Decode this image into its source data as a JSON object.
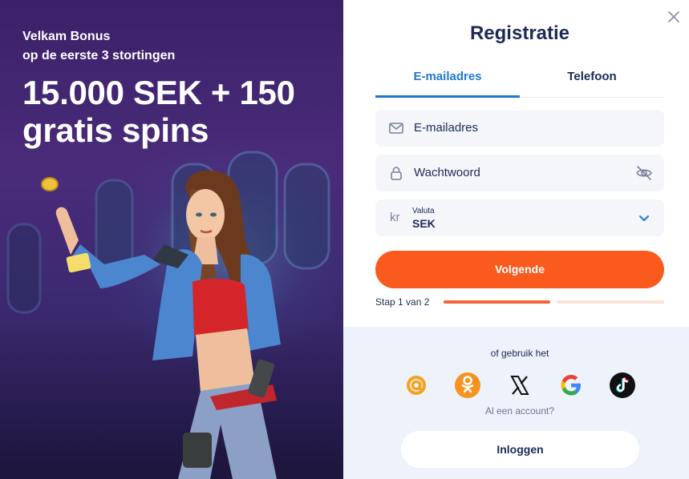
{
  "promo": {
    "line1": "Velkam Bonus",
    "line2": "op de eerste 3 stortingen",
    "title_line1": "15.000 SEK + 150",
    "title_line2": "gratis spins"
  },
  "registration": {
    "title": "Registratie",
    "tabs": [
      {
        "label": "E-mailadres",
        "active": true
      },
      {
        "label": "Telefoon",
        "active": false
      }
    ],
    "email_label": "E-mailadres",
    "password_label": "Wachtwoord",
    "currency": {
      "symbol": "kr",
      "caption": "Valuta",
      "value": "SEK"
    },
    "next_button": "Volgende",
    "step_text": "Stap 1 van 2",
    "step_progress": 0.5
  },
  "social": {
    "or_text": "of gebruik het",
    "providers": [
      "mail-ru-icon",
      "odnoklassniki-icon",
      "x-icon",
      "google-icon",
      "tiktok-icon"
    ],
    "have_account": "Al een account?",
    "login_button": "Inloggen"
  },
  "colors": {
    "accent_orange": "#fa5a1e",
    "tab_blue": "#1f78d1",
    "text_navy": "#1c2a55"
  }
}
